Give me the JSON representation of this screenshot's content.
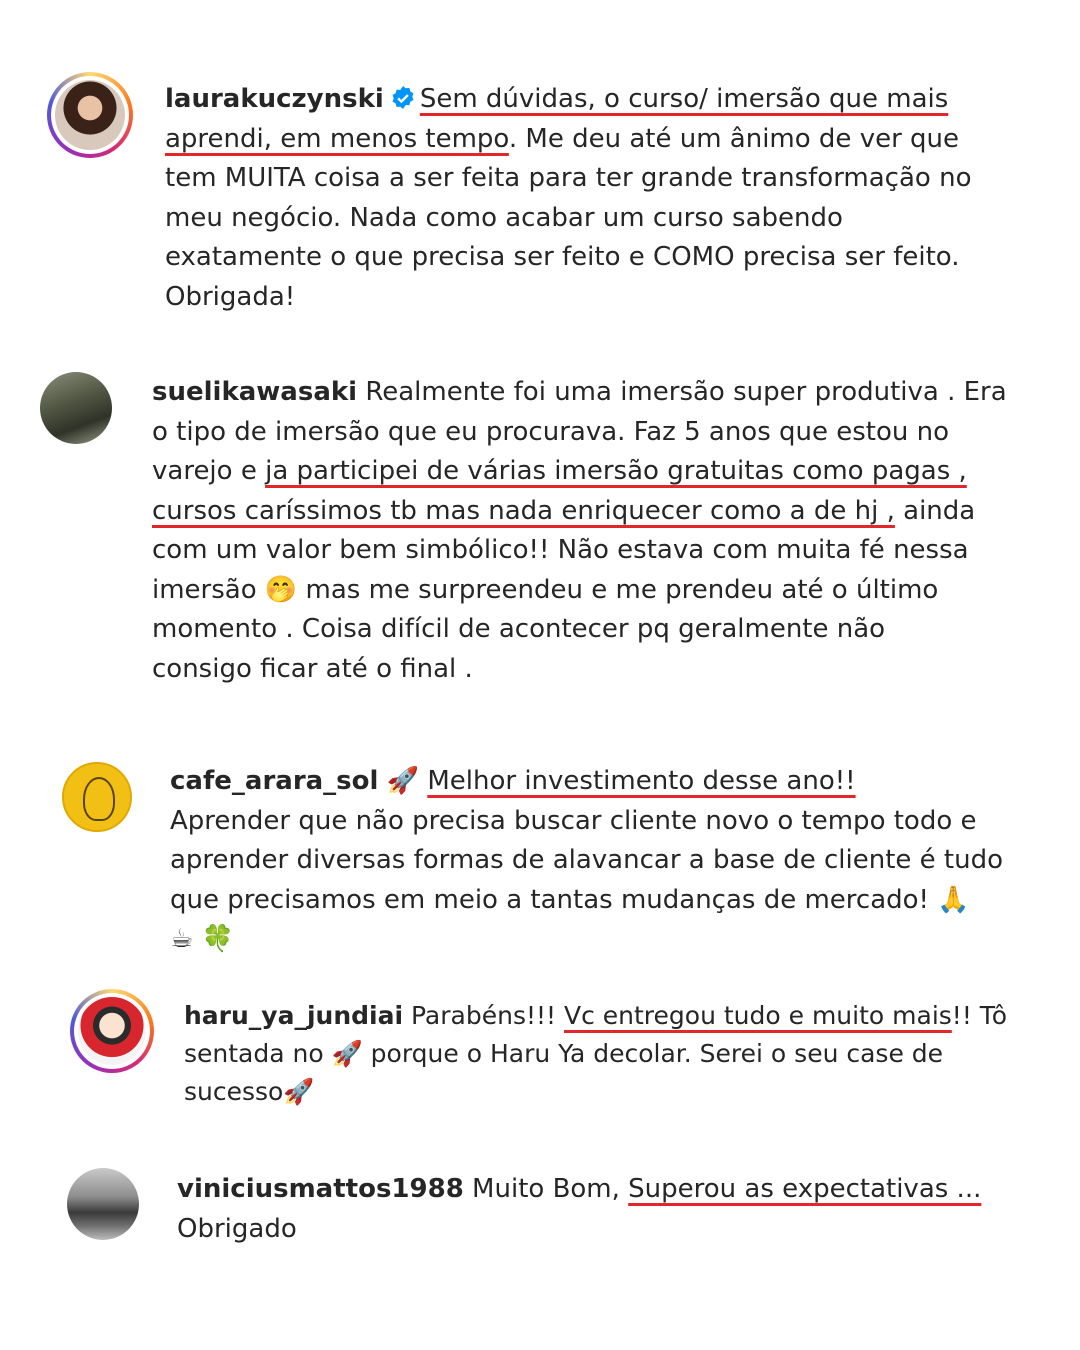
{
  "comments": [
    {
      "username": "laurakuczynski",
      "verified": true,
      "avatar": "woman-portrait-avatar",
      "lines": [
        {
          "pre": "",
          "ul": "Sem dúvidas, o curso/ imersão que mais",
          "post": ""
        },
        {
          "pre": "",
          "ul": "aprendi, em menos tempo",
          "post": ". Me deu até um ânimo de ver que"
        },
        {
          "pre": "tem MUITA coisa a ser feita para ter grande transformação no",
          "ul": "",
          "post": ""
        },
        {
          "pre": "meu negócio. Nada como acabar um curso sabendo",
          "ul": "",
          "post": ""
        },
        {
          "pre": "exatamente o que precisa ser feito e COMO precisa ser feito.",
          "ul": "",
          "post": ""
        },
        {
          "pre": "Obrigada!",
          "ul": "",
          "post": ""
        }
      ]
    },
    {
      "username": "suelikawasaki",
      "avatar": "outdoor-photo-avatar",
      "lines": [
        {
          "pre": " Realmente foi uma imersão super produtiva . Era",
          "ul": "",
          "post": ""
        },
        {
          "pre": "o tipo de imersão que eu procurava. Faz 5 anos que estou no",
          "ul": "",
          "post": ""
        },
        {
          "pre": "varejo e ",
          "ul": "ja participei de várias imersão gratuitas como pagas ,",
          "post": ""
        },
        {
          "pre": "",
          "ul": "cursos caríssimos tb mas nada enriquecer como a de hj ,",
          "post": " ainda"
        },
        {
          "pre": "com um valor bem simbólico!! Não estava com muita fé nessa",
          "ul": "",
          "post": ""
        },
        {
          "pre": "imersão 🤭 mas me surpreendeu e me prendeu até o último",
          "ul": "",
          "post": ""
        },
        {
          "pre": "momento . Coisa difícil de acontecer pq geralmente não",
          "ul": "",
          "post": ""
        },
        {
          "pre": "consigo ficar até o final .",
          "ul": "",
          "post": ""
        }
      ]
    },
    {
      "username": "cafe_arara_sol",
      "avatar": "yellow-logo-avatar",
      "lines": [
        {
          "pre": " 🚀 ",
          "ul": "Melhor investimento desse ano!!",
          "post": ""
        },
        {
          "pre": "Aprender que não precisa buscar cliente novo o tempo todo e",
          "ul": "",
          "post": ""
        },
        {
          "pre": "aprender diversas formas de alavancar a base de cliente é tudo",
          "ul": "",
          "post": ""
        },
        {
          "pre": "que precisamos em meio a tantas mudanças de mercado! 🙏",
          "ul": "",
          "post": ""
        },
        {
          "pre": "☕ 🍀",
          "ul": "",
          "post": ""
        }
      ]
    },
    {
      "username": "haru_ya_jundiai",
      "avatar": "cartoon-avatar",
      "lines": [
        {
          "pre": " Parabéns!!! ",
          "ul": "Vc entregou tudo e muito mais",
          "post": "!! Tô"
        },
        {
          "pre": "sentada no 🚀 porque o Haru Ya decolar. Serei o seu case de",
          "ul": "",
          "post": ""
        },
        {
          "pre": "sucesso🚀",
          "ul": "",
          "post": ""
        }
      ]
    },
    {
      "username": "viniciusmattos1988",
      "avatar": "car-photo-avatar",
      "lines": [
        {
          "pre": " Muito Bom, ",
          "ul": "Superou as expectativas ...",
          "post": ""
        },
        {
          "pre": "Obrigado",
          "ul": "",
          "post": ""
        }
      ]
    }
  ],
  "colors": {
    "underline": "#e2262a",
    "verified": "#0095f6",
    "text": "#262626"
  }
}
